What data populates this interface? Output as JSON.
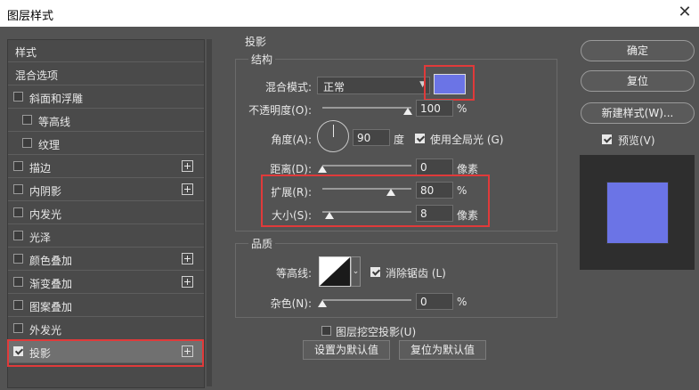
{
  "window": {
    "title": "图层样式",
    "close_glyph": "✕"
  },
  "sidebar": {
    "items": [
      {
        "label": "样式",
        "checkbox": false,
        "checked": false,
        "plus": false
      },
      {
        "label": "混合选项",
        "checkbox": false,
        "checked": false,
        "plus": false
      },
      {
        "label": "斜面和浮雕",
        "checkbox": true,
        "checked": false,
        "plus": false
      },
      {
        "label": "等高线",
        "checkbox": true,
        "checked": false,
        "plus": false
      },
      {
        "label": "纹理",
        "checkbox": true,
        "checked": false,
        "plus": false
      },
      {
        "label": "描边",
        "checkbox": true,
        "checked": false,
        "plus": true
      },
      {
        "label": "内阴影",
        "checkbox": true,
        "checked": false,
        "plus": true
      },
      {
        "label": "内发光",
        "checkbox": true,
        "checked": false,
        "plus": false
      },
      {
        "label": "光泽",
        "checkbox": true,
        "checked": false,
        "plus": false
      },
      {
        "label": "颜色叠加",
        "checkbox": true,
        "checked": false,
        "plus": true
      },
      {
        "label": "渐变叠加",
        "checkbox": true,
        "checked": false,
        "plus": true
      },
      {
        "label": "图案叠加",
        "checkbox": true,
        "checked": false,
        "plus": false
      },
      {
        "label": "外发光",
        "checkbox": true,
        "checked": false,
        "plus": false
      },
      {
        "label": "投影",
        "checkbox": true,
        "checked": true,
        "plus": true,
        "selected": true
      }
    ]
  },
  "main": {
    "section_title": "投影",
    "structure": {
      "title": "结构",
      "blend_mode_label": "混合模式:",
      "blend_mode_value": "正常",
      "shadow_color": "#6b74e6",
      "opacity_label": "不透明度(O):",
      "opacity_value": "100",
      "opacity_unit": "%",
      "angle_label": "角度(A):",
      "angle_value": "90",
      "angle_unit": "度",
      "global_light_label": "使用全局光 (G)",
      "global_light_checked": true,
      "distance_label": "距离(D):",
      "distance_value": "0",
      "distance_unit": "像素",
      "spread_label": "扩展(R):",
      "spread_value": "80",
      "spread_unit": "%",
      "size_label": "大小(S):",
      "size_value": "8",
      "size_unit": "像素"
    },
    "quality": {
      "title": "品质",
      "contour_label": "等高线:",
      "antialias_label": "消除锯齿 (L)",
      "antialias_checked": true,
      "noise_label": "杂色(N):",
      "noise_value": "0",
      "noise_unit": "%"
    },
    "knockout_label": "图层挖空投影(U)",
    "knockout_checked": false,
    "make_default_label": "设置为默认值",
    "reset_default_label": "复位为默认值"
  },
  "right": {
    "ok_label": "确定",
    "reset_label": "复位",
    "new_style_label": "新建样式(W)...",
    "preview_label": "预览(V)",
    "preview_checked": true,
    "preview_swatch_color": "#6b74e6"
  }
}
